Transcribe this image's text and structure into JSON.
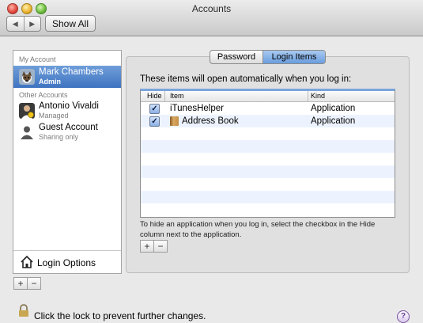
{
  "window": {
    "title": "Accounts",
    "show_all_label": "Show All",
    "back_label": "◀",
    "forward_label": "▶"
  },
  "sidebar": {
    "my_account_header": "My Account",
    "other_accounts_header": "Other Accounts",
    "accounts": [
      {
        "name": "Mark Chambers",
        "status": "Admin"
      },
      {
        "name": "Antonio Vivaldi",
        "status": "Managed"
      },
      {
        "name": "Guest Account",
        "status": "Sharing only"
      }
    ],
    "login_options_label": "Login Options",
    "add_label": "+",
    "remove_label": "−"
  },
  "tabs": {
    "password": "Password",
    "login_items": "Login Items",
    "selected": "Login Items"
  },
  "login_items": {
    "description": "These items will open automatically when you log in:",
    "columns": {
      "hide": "Hide",
      "item": "Item",
      "kind": "Kind"
    },
    "rows": [
      {
        "hidden": "✓",
        "item": "iTunesHelper",
        "kind": "Application"
      },
      {
        "hidden": "✓",
        "item": "Address Book",
        "kind": "Application"
      }
    ],
    "hint": "To hide an application when you log in, select the checkbox in the Hide column next to the application.",
    "add_label": "+",
    "remove_label": "−"
  },
  "footer": {
    "lock_text": "Click the lock to prevent further changes.",
    "help_label": "?"
  }
}
